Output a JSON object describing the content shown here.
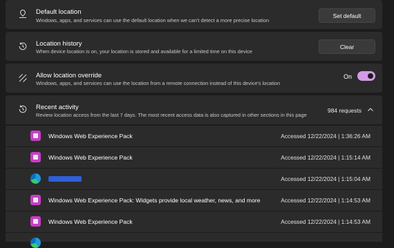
{
  "default_location": {
    "title": "Default location",
    "description": "Windows, apps, and services can use the default location when we can't detect a more precise location",
    "button": "Set default",
    "icon": "location-pin-icon"
  },
  "location_history": {
    "title": "Location history",
    "description": "When device location is on, your location is stored and available for a limited time on this device",
    "button": "Clear",
    "icon": "history-icon"
  },
  "location_override": {
    "title": "Allow location override",
    "description": "Windows, apps, and services can use the location from a remote connection instead of this device's location",
    "toggle_label": "On",
    "toggle_state": true,
    "icon": "override-arrows-icon"
  },
  "recent_activity": {
    "title": "Recent activity",
    "description": "Review location access from the last 7 days. The most recent access data is also captured in other sections in this page",
    "count": "984 requests",
    "icon": "history-icon",
    "items": [
      {
        "name": "Windows Web Experience Pack",
        "time": "Accessed 12/22/2024  |  1:36:26 AM",
        "icon": "package-icon"
      },
      {
        "name": "Windows Web Experience Pack",
        "time": "Accessed 12/22/2024  |  1:15:14 AM",
        "icon": "package-icon"
      },
      {
        "name": "",
        "time": "Accessed 12/22/2024  |  1:15:04 AM",
        "icon": "edge-icon"
      },
      {
        "name": "Windows Web Experience Pack: Widgets provide local weather, news, and more",
        "time": "Accessed 12/22/2024  |  1:14:53 AM",
        "icon": "package-icon"
      },
      {
        "name": "Windows Web Experience Pack",
        "time": "Accessed 12/22/2024  |  1:14:53 AM",
        "icon": "package-icon"
      }
    ]
  },
  "colors": {
    "accent": "#d49ae8",
    "card": "#2b2b2b",
    "background": "#1c1c1c"
  }
}
